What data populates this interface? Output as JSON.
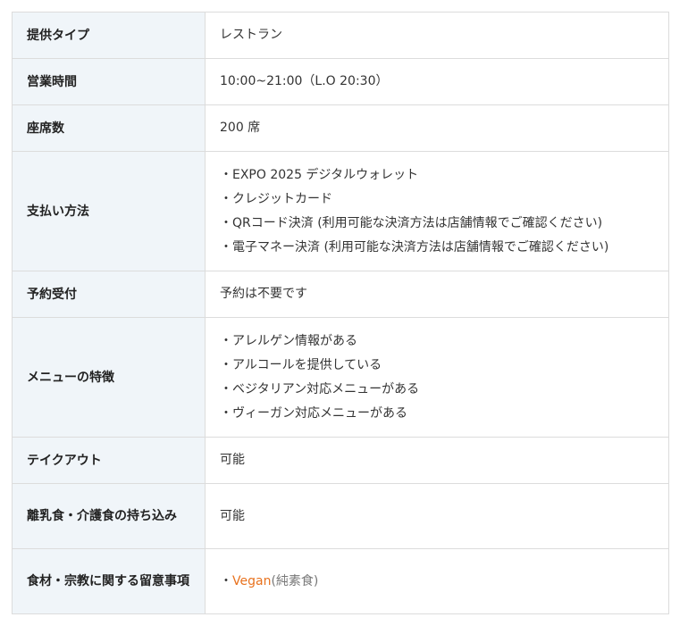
{
  "rows": [
    {
      "label": "提供タイプ",
      "value": "レストラン"
    },
    {
      "label": "営業時間",
      "value": "10:00~21:00（L.O 20:30）"
    },
    {
      "label": "座席数",
      "value": "200 席"
    },
    {
      "label": "支払い方法",
      "items": [
        "・EXPO 2025 デジタルウォレット",
        "・クレジットカード",
        "・QRコード決済 (利用可能な決済方法は店舗情報でご確認ください)",
        "・電子マネー決済 (利用可能な決済方法は店舗情報でご確認ください)"
      ]
    },
    {
      "label": "予約受付",
      "value": "予約は不要です"
    },
    {
      "label": "メニューの特徴",
      "items": [
        "・アレルゲン情報がある",
        "・アルコールを提供している",
        "・ベジタリアン対応メニューがある",
        "・ヴィーガン対応メニューがある"
      ]
    },
    {
      "label": "テイクアウト",
      "value": "可能"
    },
    {
      "label": "離乳食・介護食の持ち込み",
      "value": "可能"
    },
    {
      "label": "食材・宗教に関する留意事項",
      "bullet": "・",
      "link": "Vegan",
      "note": "(純素食)"
    }
  ],
  "colors": {
    "header_bg": "#f0f5f9",
    "border": "#dcdcdc",
    "link": "#e8721e"
  }
}
